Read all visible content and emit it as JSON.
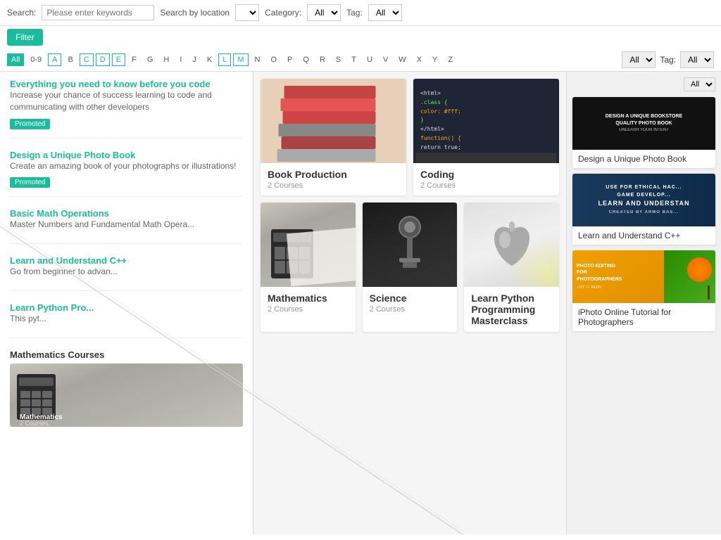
{
  "search": {
    "label": "Search:",
    "placeholder": "Please enter keywords",
    "location_label": "Search by location",
    "category_label": "Category:",
    "tag_label": "Tag:",
    "filter_button": "Filter"
  },
  "alpha": {
    "items": [
      "All",
      "0-9",
      "A",
      "B",
      "C",
      "D",
      "E",
      "F",
      "G",
      "H",
      "I",
      "J",
      "K",
      "L",
      "M",
      "N",
      "O",
      "P",
      "Q",
      "R",
      "S",
      "T",
      "U",
      "V",
      "W",
      "X",
      "Y",
      "Z"
    ],
    "active": "All",
    "outlined": [
      "C",
      "D",
      "E",
      "L",
      "M"
    ]
  },
  "filter2": {
    "all_label": "All",
    "tag_label": "Tag:",
    "tag_value": "All"
  },
  "courses": [
    {
      "title": "Everything you need to know before you code",
      "desc": "Increase your chance of success learning to code and communicating with other developers",
      "promoted": true
    },
    {
      "title": "Design a Unique Photo Book",
      "desc": "Create an amazing book of your photographs or illustrations!",
      "promoted": true
    },
    {
      "title": "Basic Math Operations",
      "desc": "Master Numbers and Fundamental Math Operations",
      "promoted": false
    },
    {
      "title": "Learn and Understand C++",
      "desc": "Go from beginner to advanced...",
      "promoted": false
    },
    {
      "title": "Learn Python Pro...",
      "desc": "This pyt...",
      "promoted": false
    }
  ],
  "category_cards": [
    {
      "id": "book-production",
      "title": "Book Production",
      "count": "2 Courses",
      "img_type": "books"
    },
    {
      "id": "coding",
      "title": "Coding",
      "count": "2 Courses",
      "img_type": "laptop"
    },
    {
      "id": "mathematics",
      "title": "Mathematics",
      "count": "2 Courses",
      "img_type": "calculator"
    },
    {
      "id": "science",
      "title": "Science",
      "count": "2 Courses",
      "img_type": "microscope"
    },
    {
      "id": "apple",
      "title": "Learn Python Programming Masterclass",
      "count": "",
      "img_type": "apple"
    }
  ],
  "detail_cards": [
    {
      "id": "photo-book",
      "title": "Design a Unique Photo Book",
      "img_type": "photobook"
    },
    {
      "id": "learn-cpp",
      "title": "Learn and Understand C++",
      "img_type": "learn"
    },
    {
      "id": "photo-editing",
      "title": "iPhoto Online Tutorial for Photographers",
      "img_type": "photo"
    }
  ],
  "right_filter": {
    "all_label": "All",
    "tag_label": "Tag:",
    "tag_value": "All"
  },
  "math_courses": "Mathematics Courses",
  "promoted_label": "Promoted",
  "diagonal_note": "diagonal overlay visible"
}
